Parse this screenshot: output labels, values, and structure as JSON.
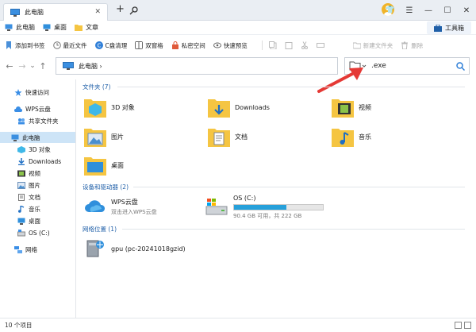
{
  "tab": {
    "title": "此电脑",
    "close": "✕"
  },
  "window": {
    "new_tab": "+",
    "minimize": "—",
    "maximize": "☐",
    "close": "✕",
    "shirt": "👕",
    "menu": "☰"
  },
  "bookmarks": [
    {
      "label": "此电脑",
      "icon": "pc-icon"
    },
    {
      "label": "桌面",
      "icon": "desktop-icon"
    },
    {
      "label": "文章",
      "icon": "folder-icon"
    }
  ],
  "toolbox": {
    "label": "工具箱"
  },
  "toolbar": [
    {
      "label": "添加到书签",
      "icon": "bookmark-add-icon",
      "color": "#4a90d9"
    },
    {
      "label": "最近文件",
      "icon": "clock-icon",
      "color": "#888888"
    },
    {
      "label": "C盘清理",
      "icon": "clean-icon",
      "color": "#2f7fd8"
    },
    {
      "label": "双窗格",
      "icon": "dual-pane-icon",
      "color": "#888888"
    },
    {
      "label": "私密空间",
      "icon": "lock-icon",
      "color": "#e05a3a"
    },
    {
      "label": "快速预览",
      "icon": "eye-icon",
      "color": "#888888"
    }
  ],
  "toolbar_right": [
    {
      "label": "新建文件夹",
      "icon": "new-folder-icon"
    },
    {
      "label": "删除",
      "icon": "delete-icon"
    }
  ],
  "nav": {
    "back": "←",
    "forward": "→",
    "recent": "⌄",
    "up": "↑"
  },
  "address": {
    "path": "此电脑  ›"
  },
  "search": {
    "value": ".exe"
  },
  "sidebar": [
    {
      "label": "快速访问",
      "icon": "star-icon",
      "indent": 0
    },
    {
      "label": "WPS云盘",
      "icon": "cloud-icon",
      "indent": 0
    },
    {
      "label": "共享文件夹",
      "icon": "shared-folder-icon",
      "indent": 1
    },
    {
      "label": "此电脑",
      "icon": "pc-icon",
      "indent": 0,
      "selected": true
    },
    {
      "label": "3D 对象",
      "icon": "cube-icon",
      "indent": 1
    },
    {
      "label": "Downloads",
      "icon": "download-icon",
      "indent": 1
    },
    {
      "label": "视频",
      "icon": "video-icon",
      "indent": 1
    },
    {
      "label": "图片",
      "icon": "picture-icon",
      "indent": 1
    },
    {
      "label": "文档",
      "icon": "document-icon",
      "indent": 1
    },
    {
      "label": "音乐",
      "icon": "music-icon",
      "indent": 1
    },
    {
      "label": "桌面",
      "icon": "desktop-icon",
      "indent": 1
    },
    {
      "label": "OS (C:)",
      "icon": "drive-icon",
      "indent": 1
    },
    {
      "label": "网络",
      "icon": "network-icon",
      "indent": 0
    }
  ],
  "sections": {
    "folders": "文件夹 (7)",
    "devices": "设备和驱动器 (2)",
    "network": "网络位置 (1)"
  },
  "folders": [
    {
      "label": "3D 对象",
      "icon": "3d-objects-folder-icon"
    },
    {
      "label": "Downloads",
      "icon": "downloads-folder-icon"
    },
    {
      "label": "视频",
      "icon": "videos-folder-icon"
    },
    {
      "label": "图片",
      "icon": "pictures-folder-icon"
    },
    {
      "label": "文档",
      "icon": "documents-folder-icon"
    },
    {
      "label": "音乐",
      "icon": "music-folder-icon"
    },
    {
      "label": "桌面",
      "icon": "desktop-folder-icon"
    }
  ],
  "devices": {
    "wps": {
      "title": "WPS云盘",
      "subtitle": "双击进入WPS云盘"
    },
    "drive": {
      "title": "OS (C:)",
      "free_text": "90.4 GB 可用，共 222 GB",
      "used_fraction": 0.593,
      "bar_color": "#26a0da"
    }
  },
  "network": {
    "label": "gpu (pc-20241018gzid)"
  },
  "status": {
    "text": "10 个项目"
  },
  "colors": {
    "accent": "#1f5fa8",
    "arrow": "#e53935",
    "selected": "#cde4f7"
  }
}
